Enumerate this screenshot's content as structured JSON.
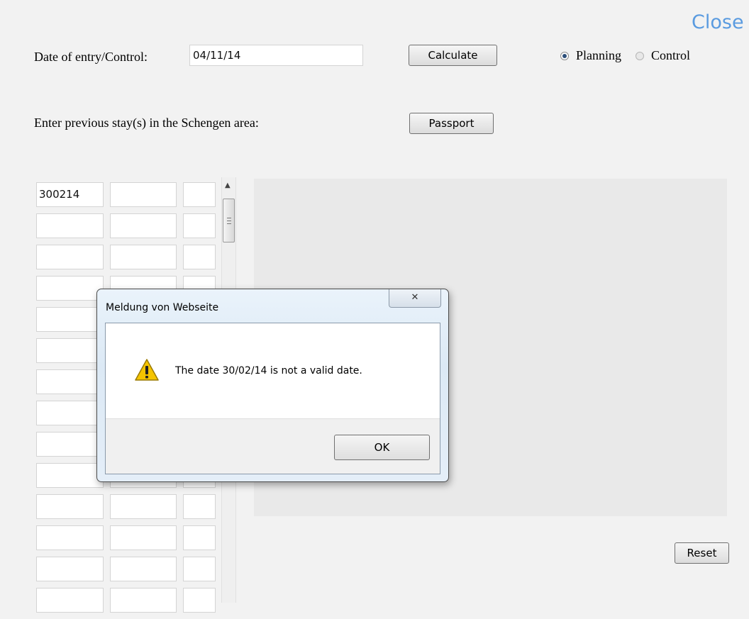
{
  "header": {
    "close_label": "Close",
    "date_label": "Date of entry/Control:",
    "date_value": "04/11/14",
    "calculate_label": "Calculate",
    "mode_options": [
      {
        "label": "Planning",
        "checked": true
      },
      {
        "label": "Control",
        "checked": false
      }
    ]
  },
  "stays": {
    "prompt": "Enter previous stay(s) in the Schengen area:",
    "passport_label": "Passport",
    "rows": [
      [
        "300214",
        "",
        ""
      ],
      [
        "",
        "",
        ""
      ],
      [
        "",
        "",
        ""
      ],
      [
        "",
        "",
        ""
      ],
      [
        "",
        "",
        ""
      ],
      [
        "",
        "",
        ""
      ],
      [
        "",
        "",
        ""
      ],
      [
        "",
        "",
        ""
      ],
      [
        "",
        "",
        ""
      ],
      [
        "",
        "",
        ""
      ],
      [
        "",
        "",
        ""
      ],
      [
        "",
        "",
        ""
      ],
      [
        "",
        "",
        ""
      ],
      [
        "",
        "",
        ""
      ]
    ]
  },
  "footer": {
    "reset_label": "Reset"
  },
  "dialog": {
    "title": "Meldung von Webseite",
    "close_glyph": "✕",
    "icon": "warning-icon",
    "message": "The date 30/02/14 is not a valid date.",
    "ok_label": "OK"
  },
  "colors": {
    "close_link": "#5a9be0",
    "background": "#f2f2f2",
    "output_panel": "#e9e9e9",
    "warning_yellow": "#f5c400"
  }
}
